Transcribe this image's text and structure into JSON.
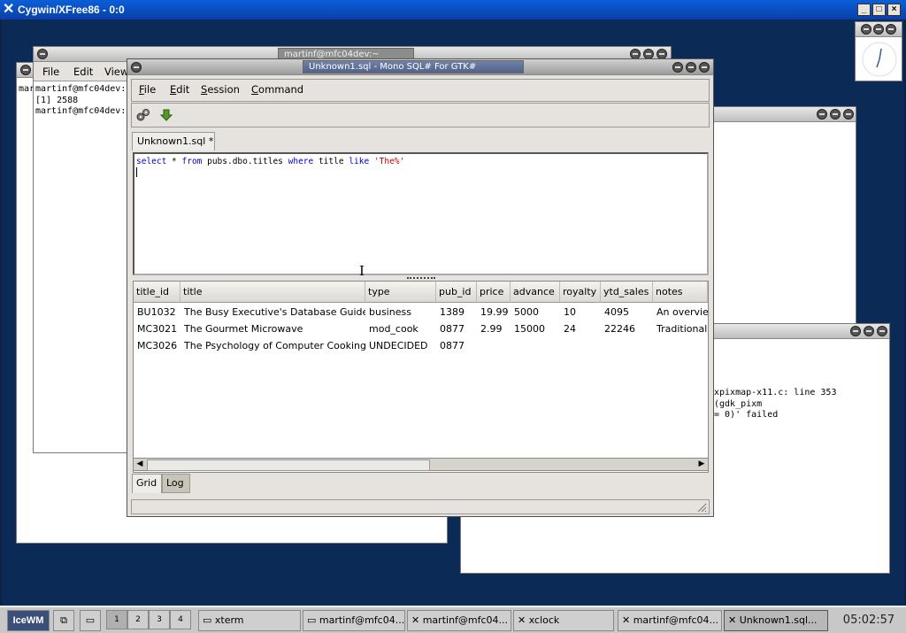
{
  "outer_window": {
    "title": "Cygwin/XFree86 - 0:0"
  },
  "xterm_window": {
    "title": "martinf@mfc04dev:~",
    "menu": [
      "File",
      "Edit",
      "View"
    ],
    "left_partial": "mar",
    "lines": [
      "martinf@mfc04dev:",
      "[1] 2588",
      "martinf@mfc04dev:"
    ]
  },
  "error_window": {
    "lines": [
      "xpixmap-x11.c: line 353 (gdk_pixm",
      "= 0)' failed"
    ]
  },
  "sql_window": {
    "title": "Unknown1.sql - Mono SQL# For GTK#",
    "menu": [
      {
        "label": "File",
        "ul": "F",
        "rest": "ile"
      },
      {
        "label": "Edit",
        "ul": "E",
        "rest": "dit"
      },
      {
        "label": "Session",
        "ul": "S",
        "rest": "ession"
      },
      {
        "label": "Command",
        "ul": "C",
        "rest": "ommand"
      }
    ],
    "toolbar": {
      "execute_icon": "gears-icon",
      "down_icon": "down-arrow-icon"
    },
    "tab_label": "Unknown1.sql *",
    "query": {
      "kw_select": "select",
      "star": " * ",
      "kw_from": "from",
      "table": " pubs.dbo.titles ",
      "kw_where": "where",
      "col": " title ",
      "kw_like": "like",
      "space": " ",
      "pattern": "'The%'"
    },
    "grid": {
      "columns": [
        "title_id",
        "title",
        "type",
        "pub_id",
        "price",
        "advance",
        "royalty",
        "ytd_sales",
        "notes"
      ],
      "rows": [
        [
          "BU1032",
          "The Busy Executive's Database Guide",
          "business",
          "1389",
          "19.99",
          "5000",
          "10",
          "4095",
          "An overvie"
        ],
        [
          "MC3021",
          "The Gourmet Microwave",
          "mod_cook",
          "0877",
          "2.99",
          "15000",
          "24",
          "22246",
          "Traditional"
        ],
        [
          "MC3026",
          "The Psychology of Computer Cooking",
          "UNDECIDED",
          "0877",
          "",
          "",
          "",
          "",
          ""
        ]
      ]
    },
    "bottom_tabs": [
      "Grid",
      "Log"
    ]
  },
  "taskbar": {
    "start_label": "IceWM",
    "workspaces": [
      "1",
      "2",
      "3",
      "4"
    ],
    "tasks": [
      "xterm",
      "martinf@mfc04...",
      "martinf@mfc04...",
      "xclock",
      "martinf@mfc04...",
      "Unknown1.sql..."
    ],
    "clock": "05:02:57"
  }
}
